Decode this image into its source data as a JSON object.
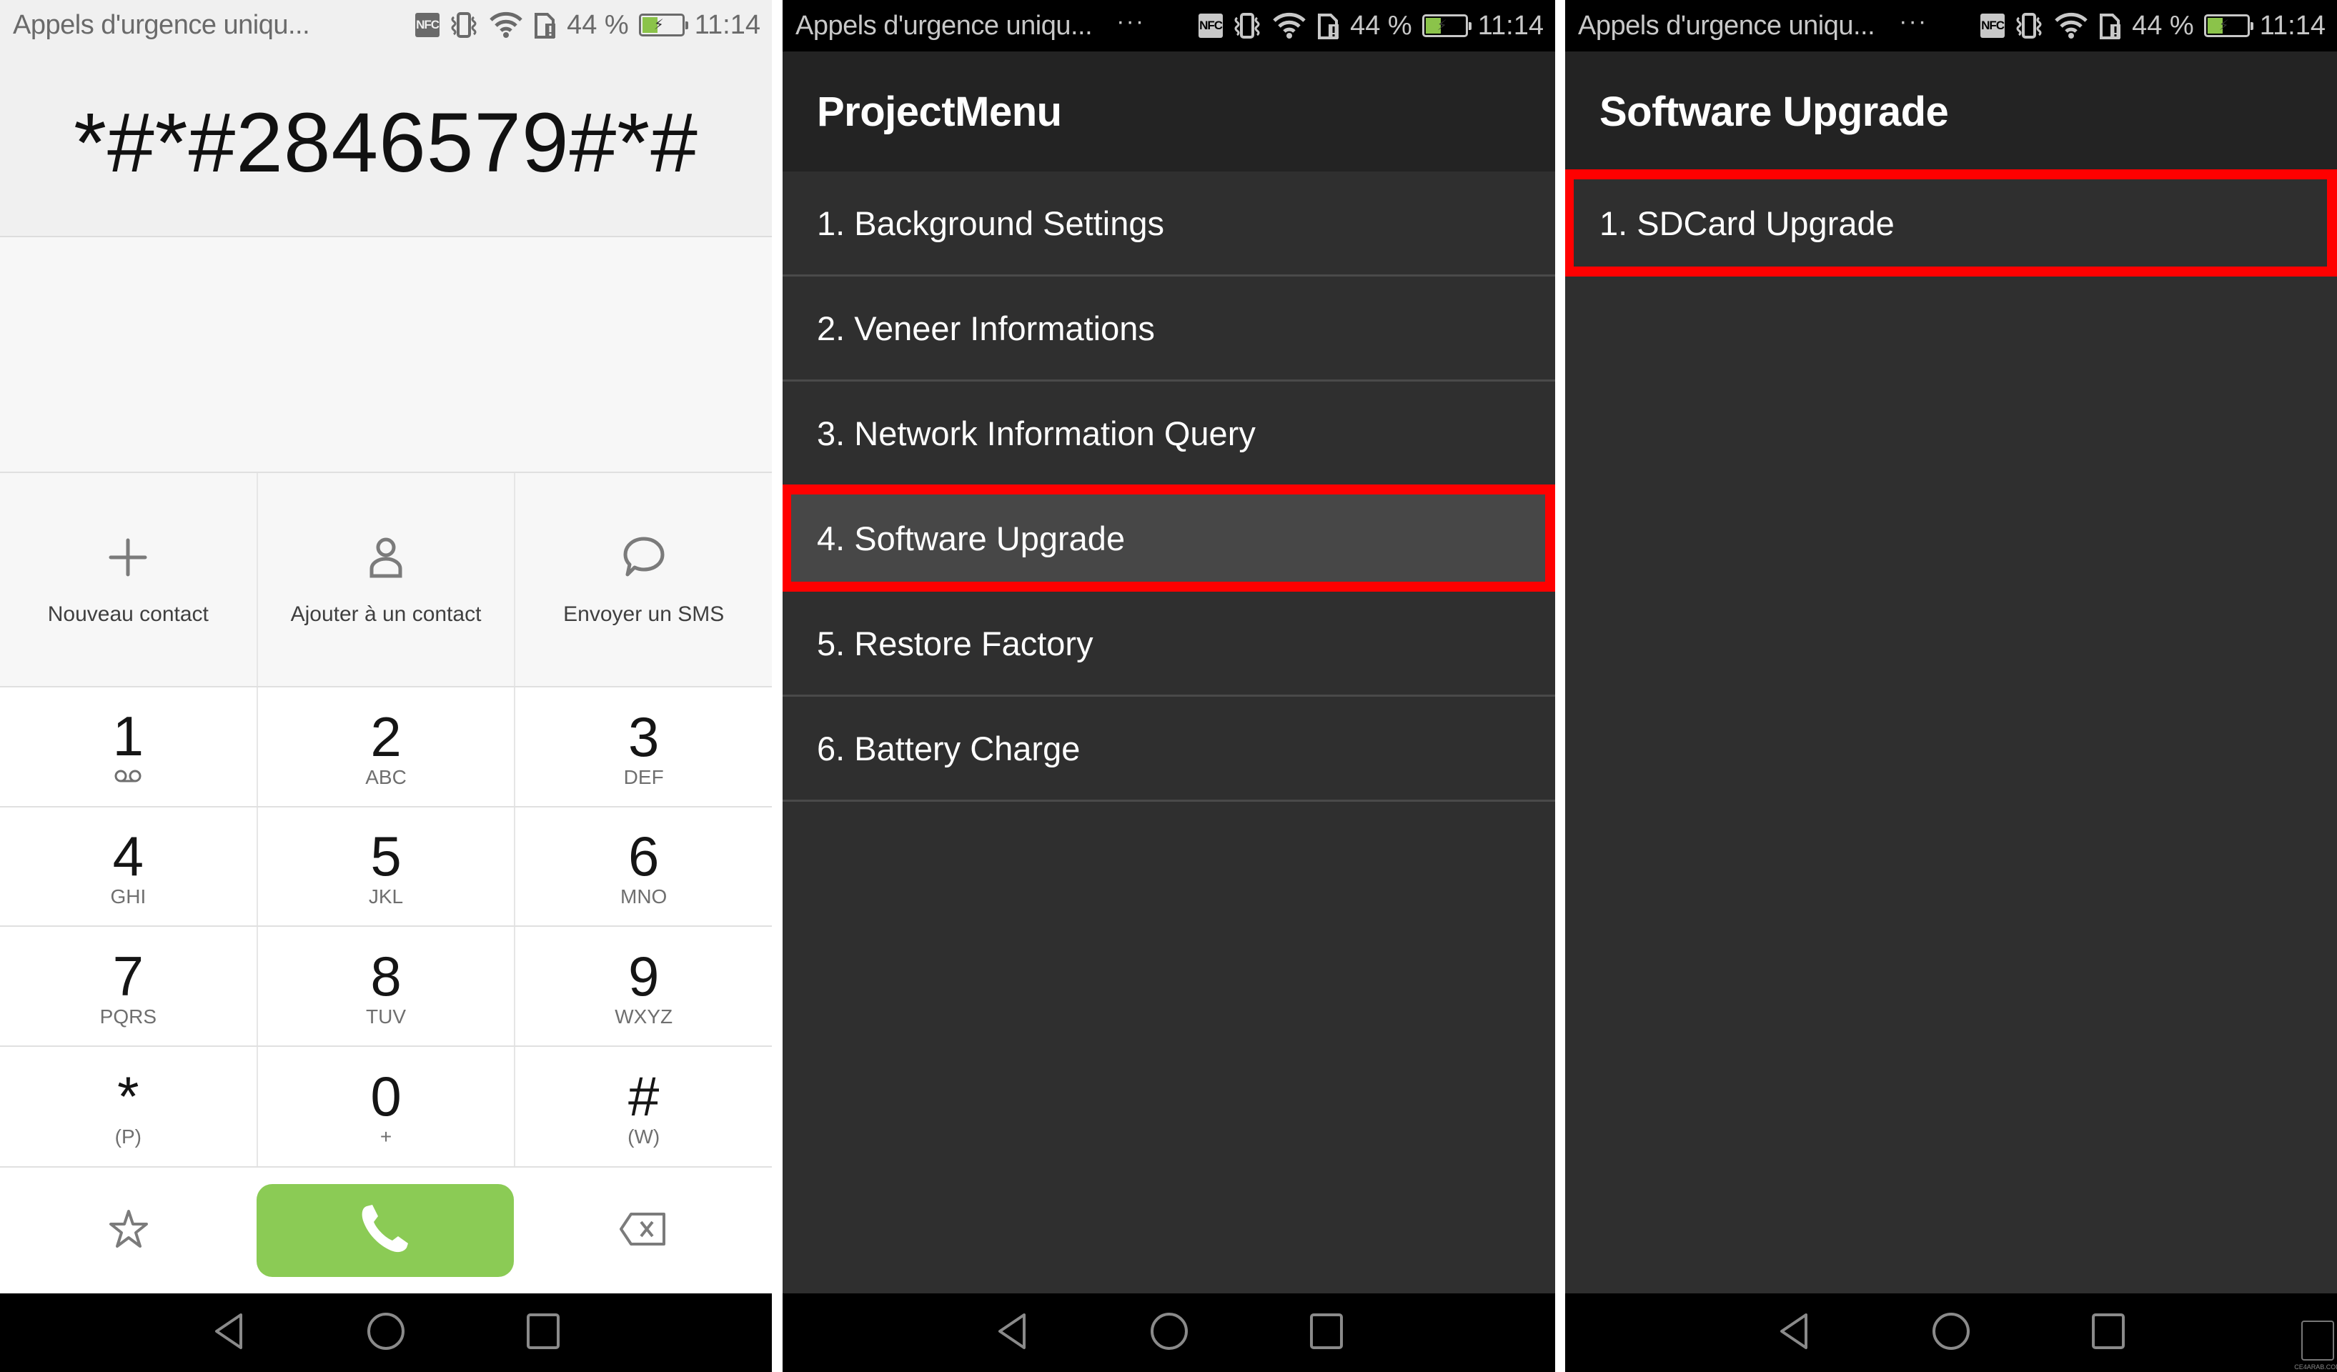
{
  "status_bar": {
    "carrier_text": "Appels d'urgence uniqu...",
    "overflow_indicator": "···",
    "nfc_label": "NFC",
    "battery_percent_text": "44 %",
    "battery_level": 0.44,
    "time": "11:14",
    "icons": [
      "nfc-icon",
      "vibrate-icon",
      "wifi-icon",
      "sim-alert-icon",
      "battery-charging-icon"
    ]
  },
  "dialer": {
    "dialed_number": "*#*#2846579#*#",
    "actions": [
      {
        "icon": "plus-icon",
        "label": "Nouveau contact"
      },
      {
        "icon": "person-icon",
        "label": "Ajouter à un contact"
      },
      {
        "icon": "chat-bubble-icon",
        "label": "Envoyer un SMS"
      }
    ],
    "keys": [
      {
        "digit": "1",
        "sub": "",
        "sub_icon": "voicemail-icon"
      },
      {
        "digit": "2",
        "sub": "ABC"
      },
      {
        "digit": "3",
        "sub": "DEF"
      },
      {
        "digit": "4",
        "sub": "GHI"
      },
      {
        "digit": "5",
        "sub": "JKL"
      },
      {
        "digit": "6",
        "sub": "MNO"
      },
      {
        "digit": "7",
        "sub": "PQRS"
      },
      {
        "digit": "8",
        "sub": "TUV"
      },
      {
        "digit": "9",
        "sub": "WXYZ"
      },
      {
        "digit": "*",
        "sub": "(P)"
      },
      {
        "digit": "0",
        "sub": "+"
      },
      {
        "digit": "#",
        "sub": "(W)"
      }
    ],
    "bottom": {
      "left_icon": "star-icon",
      "call_icon": "phone-icon",
      "call_color": "#8bcb55",
      "right_icon": "backspace-icon"
    }
  },
  "project_menu": {
    "title": "ProjectMenu",
    "items": [
      {
        "label": "1. Background Settings"
      },
      {
        "label": "2. Veneer Informations"
      },
      {
        "label": "3. Network Information Query"
      },
      {
        "label": "4. Software Upgrade",
        "highlighted": true
      },
      {
        "label": "5. Restore Factory"
      },
      {
        "label": "6. Battery Charge"
      }
    ]
  },
  "software_upgrade": {
    "title": "Software Upgrade",
    "items": [
      {
        "label": "1. SDCard Upgrade",
        "highlighted": true
      }
    ]
  },
  "navbar": {
    "buttons": [
      "back-icon",
      "home-icon",
      "recents-icon"
    ]
  },
  "annotation_color": "#ff0000",
  "watermark_text": "CE4ARAB.COM"
}
